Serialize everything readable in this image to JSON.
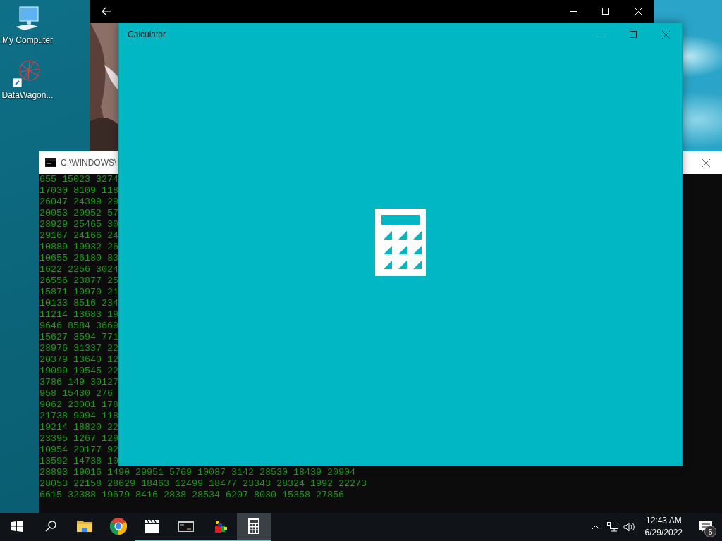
{
  "desktop_icons": [
    {
      "kind": "computer",
      "label": "My Computer"
    },
    {
      "kind": "shortcut",
      "label": "DataWagon..."
    }
  ],
  "console": {
    "title": "C:\\WINDOWS\\",
    "lines": [
      "655 15023 3274",
      "17030 8109 118",
      "26047 24399 29",
      "20053 20952 57",
      "28929 25465 30",
      "29167 24166 24",
      "10889 19932 26",
      "10655 26180 83",
      "1622 2256 3024",
      "26556 23877 25",
      "15871 10970 21",
      "10133 8516 234",
      "11214 13683 19",
      "9646 8584 3669",
      "15627 3594 771",
      "28976 31337 22",
      "20379 13640 12",
      "19099 10545 22",
      "3786 149 30127",
      "958 15430 276",
      "9062 23001 178",
      "21738 9094 118",
      "19214 18820 22",
      "23395 1267 129",
      "10954 20177 92",
      "13592 14738 10",
      "28893 19016 1490 29951 5769 10087 3142 28530 18439 20904",
      "28053 22158 28629 18463 12499 18477 23343 28324 1992 22273",
      "6615 32388 19679 8416 2838 28534 6207 8030 15358 27856"
    ]
  },
  "calculator": {
    "title": "Calculator"
  },
  "taskbar": {
    "apps": [
      {
        "kind": "start",
        "running": false,
        "selected": false
      },
      {
        "kind": "search",
        "running": false,
        "selected": false
      },
      {
        "kind": "folder",
        "running": false,
        "selected": false
      },
      {
        "kind": "browser",
        "running": false,
        "selected": false
      },
      {
        "kind": "clapper",
        "running": true,
        "selected": false
      },
      {
        "kind": "terminal",
        "running": true,
        "selected": false
      },
      {
        "kind": "cubes",
        "running": true,
        "selected": false
      },
      {
        "kind": "calculator",
        "running": true,
        "selected": true
      }
    ],
    "time": "12:43 AM",
    "date": "6/29/2022",
    "notification_count": "5"
  }
}
